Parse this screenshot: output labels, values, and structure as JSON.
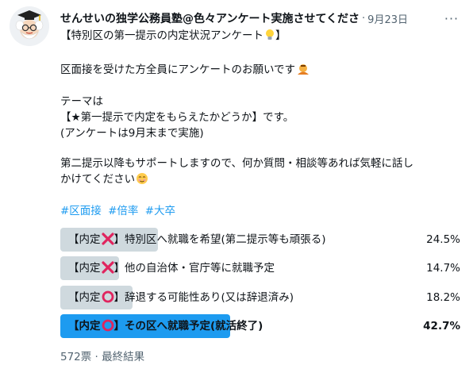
{
  "tweet": {
    "author_name": "せんせいの独学公務員塾@色々アンケート実施させてくださ",
    "separator": "·",
    "date": "9月23日",
    "more_label": "···",
    "lines": [
      "【特別区の第一提示の内定状況アンケート",
      "】",
      "区面接を受けた方全員にアンケートのお願いです",
      "テーマは",
      "【★第一提示で内定をもらえたかどうか】です。",
      "(アンケートは9月末まで実施)",
      "第二提示以降もサポートしますので、何か質問・相談等あれば気軽に話し",
      "かけてください"
    ],
    "hashtags": [
      "#区面接",
      "#倍率",
      "#大卒"
    ]
  },
  "poll": {
    "options": [
      {
        "prefix": "【内定",
        "suffix": "】特別区へ就職を希望(第二提示等も頑張る)",
        "mark": "cross",
        "percent_label": "24.5%",
        "fraction": 0.245,
        "winner": false
      },
      {
        "prefix": "【内定",
        "suffix": "】他の自治体・官庁等に就職予定",
        "mark": "cross",
        "percent_label": "14.7%",
        "fraction": 0.147,
        "winner": false
      },
      {
        "prefix": "【内定",
        "suffix": "】辞退する可能性あり(又は辞退済み)",
        "mark": "circle",
        "percent_label": "18.2%",
        "fraction": 0.182,
        "winner": false
      },
      {
        "prefix": "【内定",
        "suffix": "】その区へ就職予定(就活終了)",
        "mark": "circle",
        "percent_label": "42.7%",
        "fraction": 0.427,
        "winner": true
      }
    ],
    "footer": "572票 · 最終結果"
  },
  "colors": {
    "accent": "#1d9bf0",
    "bar": "#cfd9de",
    "cross": "#e0245e",
    "circle": "#e0245e",
    "muted": "#536471"
  },
  "icons": {
    "avatar": "professor-avatar-icon",
    "more": "more-options-icon",
    "lightbulb": "lightbulb-icon",
    "bowing": "bowing-person-icon",
    "smile": "smiling-face-icon",
    "cross": "cross-mark-icon",
    "circle": "red-circle-icon"
  }
}
